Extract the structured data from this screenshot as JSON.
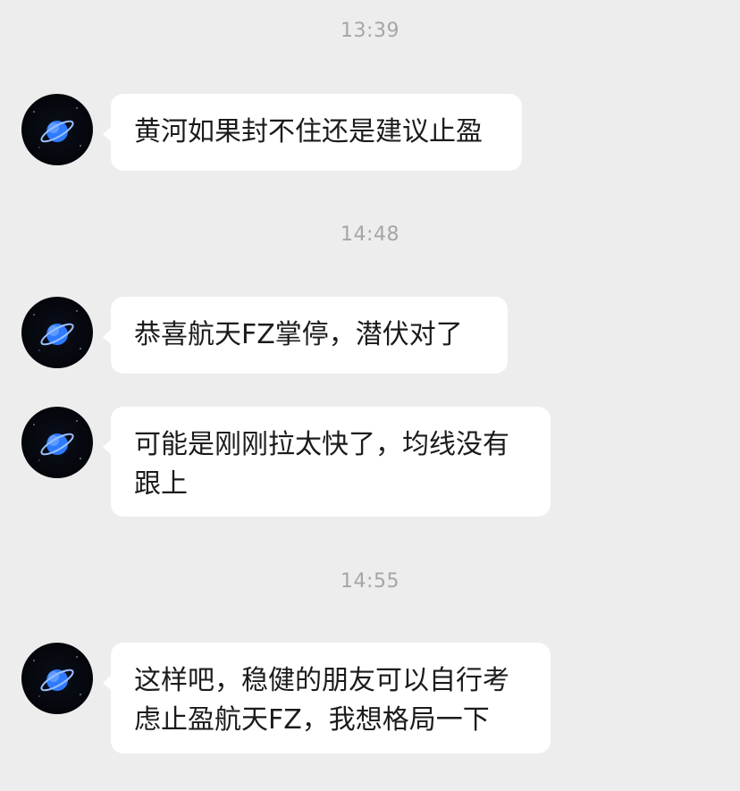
{
  "chat": {
    "colors": {
      "background": "#ededed",
      "bubble": "#ffffff",
      "timestamp": "#a6a6a6",
      "text": "#1b1b1b",
      "avatar_planet": "#2f7bff"
    },
    "timestamps": [
      "13:39",
      "14:48",
      "14:55"
    ],
    "messages": [
      {
        "text": "黄河如果封不住还是建议止盈",
        "avatar_icon": "planet-avatar-icon"
      },
      {
        "text": "恭喜航天FZ掌停，潜伏对了",
        "avatar_icon": "planet-avatar-icon"
      },
      {
        "text": "可能是刚刚拉太快了，均线没有跟上",
        "avatar_icon": "planet-avatar-icon"
      },
      {
        "text": "这样吧，稳健的朋友可以自行考虑止盈航天FZ，我想格局一下",
        "avatar_icon": "planet-avatar-icon"
      }
    ]
  }
}
